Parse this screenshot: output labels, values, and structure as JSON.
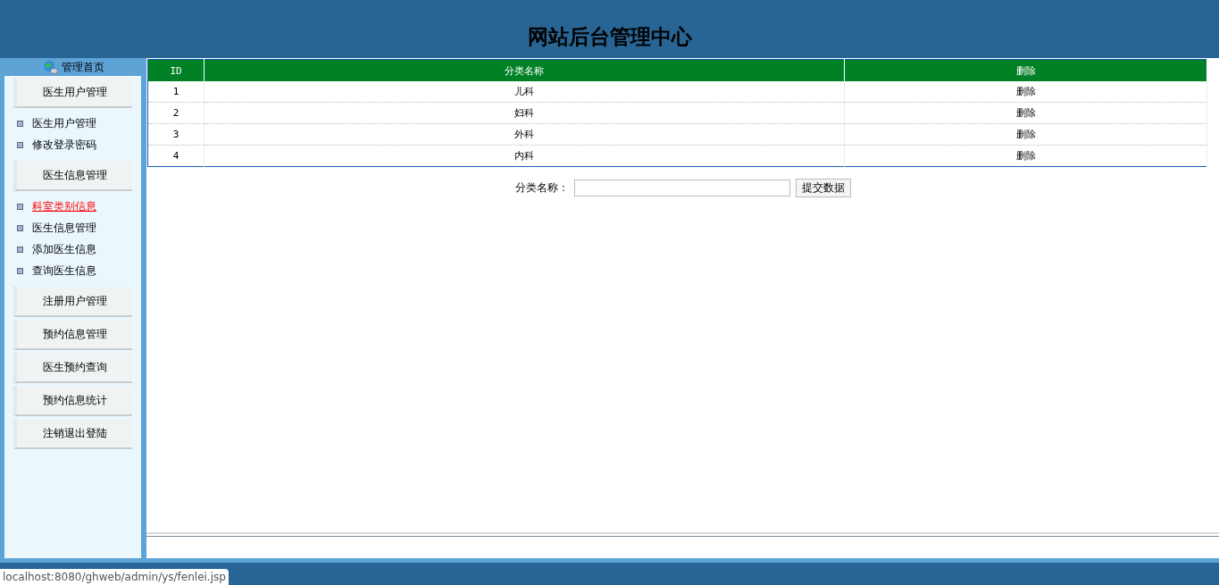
{
  "header": {
    "title": "网站后台管理中心"
  },
  "sidebar": {
    "home": "管理首页",
    "sections": [
      {
        "title": "医生用户管理",
        "items": [
          {
            "label": "医生用户管理",
            "selected": false
          },
          {
            "label": "修改登录密码",
            "selected": false
          }
        ]
      },
      {
        "title": "医生信息管理",
        "items": [
          {
            "label": "科室类别信息",
            "selected": true
          },
          {
            "label": "医生信息管理",
            "selected": false
          },
          {
            "label": "添加医生信息",
            "selected": false
          },
          {
            "label": "查询医生信息",
            "selected": false
          }
        ]
      },
      {
        "title": "注册用户管理"
      },
      {
        "title": "预约信息管理"
      },
      {
        "title": "医生预约查询"
      },
      {
        "title": "预约信息统计"
      },
      {
        "title": "注销退出登陆"
      }
    ]
  },
  "table": {
    "columns": [
      "ID",
      "分类名称",
      "删除"
    ],
    "rows": [
      [
        "1",
        "儿科",
        "删除"
      ],
      [
        "2",
        "妇科",
        "删除"
      ],
      [
        "3",
        "外科",
        "删除"
      ],
      [
        "4",
        "内科",
        "删除"
      ]
    ]
  },
  "form": {
    "label": "分类名称：",
    "submit": "提交数据"
  },
  "status_url": "localhost:8080/ghweb/admin/ys/fenlei.jsp"
}
